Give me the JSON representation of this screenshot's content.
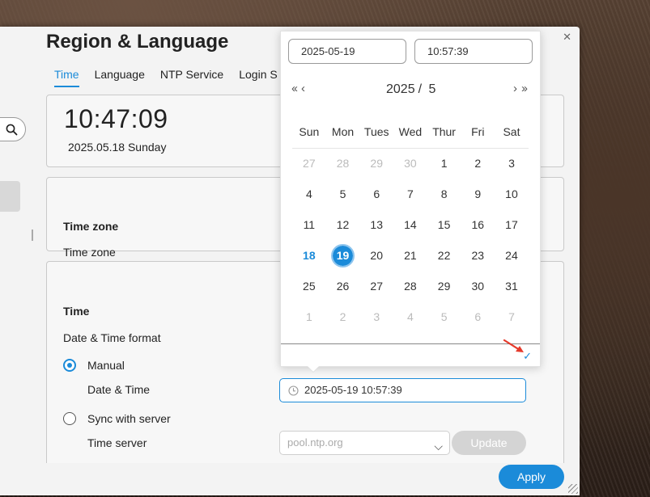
{
  "window": {
    "title": "Region & Language",
    "tabs": [
      {
        "label": "Time",
        "active": true
      },
      {
        "label": "Language",
        "active": false
      },
      {
        "label": "NTP Service",
        "active": false
      },
      {
        "label": "Login S",
        "active": false
      }
    ]
  },
  "time_card": {
    "clock": "10:47:09",
    "date": "2025.05.18 Sunday"
  },
  "timezone_card": {
    "title": "Time zone",
    "label": "Time zone"
  },
  "time_card2": {
    "title": "Time",
    "format_label": "Date & Time format",
    "manual_label": "Manual",
    "manual_selected": true,
    "datetime_label": "Date & Time",
    "datetime_value": "2025-05-19 10:57:39",
    "sync_label": "Sync with server",
    "sync_selected": false,
    "server_label": "Time server",
    "server_placeholder": "pool.ntp.org",
    "update_label": "Update"
  },
  "apply_label": "Apply",
  "picker": {
    "date_value": "2025-05-19",
    "time_value": "10:57:39",
    "year": "2025",
    "separator": "/",
    "month": "5",
    "weekdays": [
      "Sun",
      "Mon",
      "Tues",
      "Wed",
      "Thur",
      "Fri",
      "Sat"
    ],
    "weeks": [
      [
        "27",
        "28",
        "29",
        "30",
        "1",
        "2",
        "3"
      ],
      [
        "4",
        "5",
        "6",
        "7",
        "8",
        "9",
        "10"
      ],
      [
        "11",
        "12",
        "13",
        "14",
        "15",
        "16",
        "17"
      ],
      [
        "18",
        "19",
        "20",
        "21",
        "22",
        "23",
        "24"
      ],
      [
        "25",
        "26",
        "27",
        "28",
        "29",
        "30",
        "31"
      ],
      [
        "1",
        "2",
        "3",
        "4",
        "5",
        "6",
        "7"
      ]
    ],
    "today": "18",
    "selected": "19",
    "confirm_icon": "checkmark-icon"
  },
  "colors": {
    "accent": "#1b8bd9",
    "annotation_arrow": "#e53a2b"
  }
}
